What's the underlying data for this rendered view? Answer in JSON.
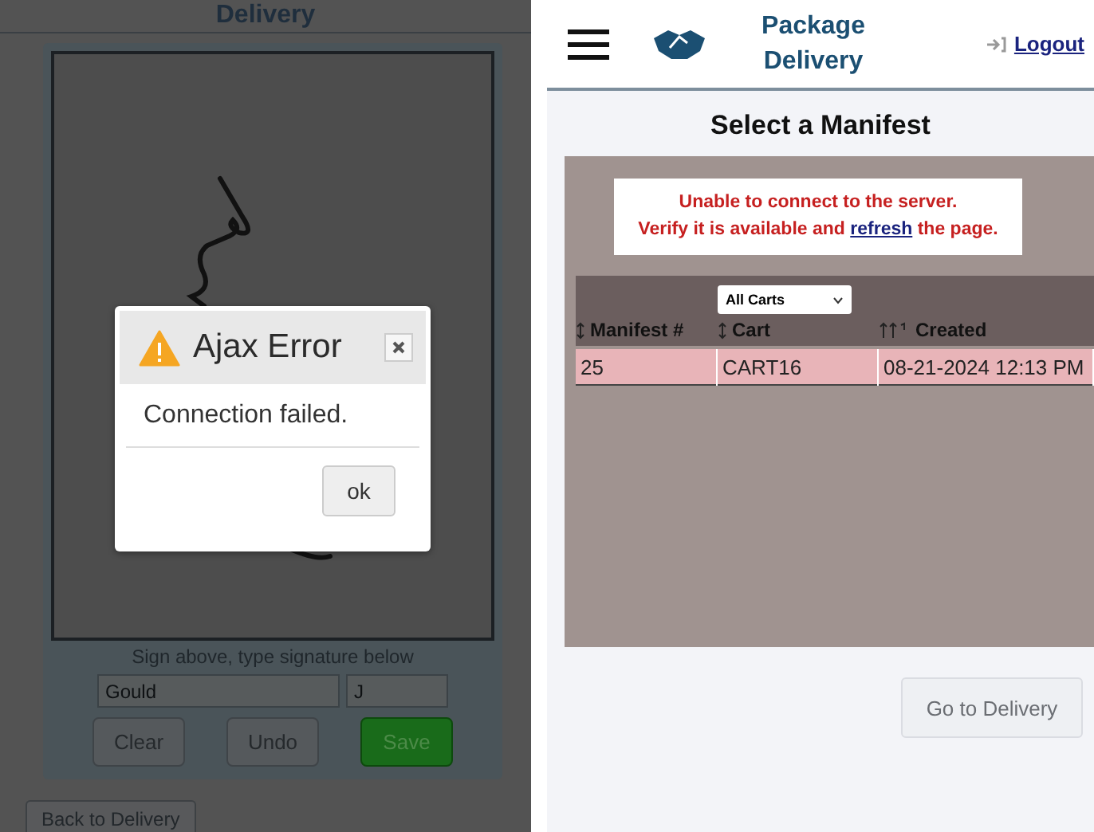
{
  "left_screen": {
    "header_title": "Delivery",
    "signature_hint": "Sign above, type signature below",
    "fields": [
      {
        "value": "Gould",
        "kind": "wide"
      },
      {
        "value": "J",
        "kind": "narrow"
      }
    ],
    "buttons": [
      {
        "label": "Clear",
        "kind": "plain"
      },
      {
        "label": "Undo",
        "kind": "plain"
      },
      {
        "label": "Save",
        "kind": "primary"
      }
    ],
    "back_button": "Back to Delivery",
    "dialog": {
      "title": "Ajax Error",
      "message": "Connection failed.",
      "button": "ok"
    }
  },
  "right_screen": {
    "header_title": "Package Delivery",
    "logout": "Logout",
    "page_title": "Select a Manifest",
    "error": {
      "line_1": "Unable to connect to the server.",
      "line_2_before": "Verify it is available and",
      "link": "refresh",
      "line_2_after": "the page."
    },
    "filter": {
      "value": "All Carts"
    },
    "table": {
      "columns": [
        {
          "label": "Manifest #",
          "kind": "updown"
        },
        {
          "label": "Cart",
          "kind": "updown"
        },
        {
          "label": "Created",
          "kind": "sorted"
        }
      ],
      "rows": [
        {
          "cells": [
            "25",
            "CART16",
            "08-21-2024 12:13 PM"
          ],
          "selected": true
        }
      ]
    },
    "go_button": "Go to Delivery"
  }
}
